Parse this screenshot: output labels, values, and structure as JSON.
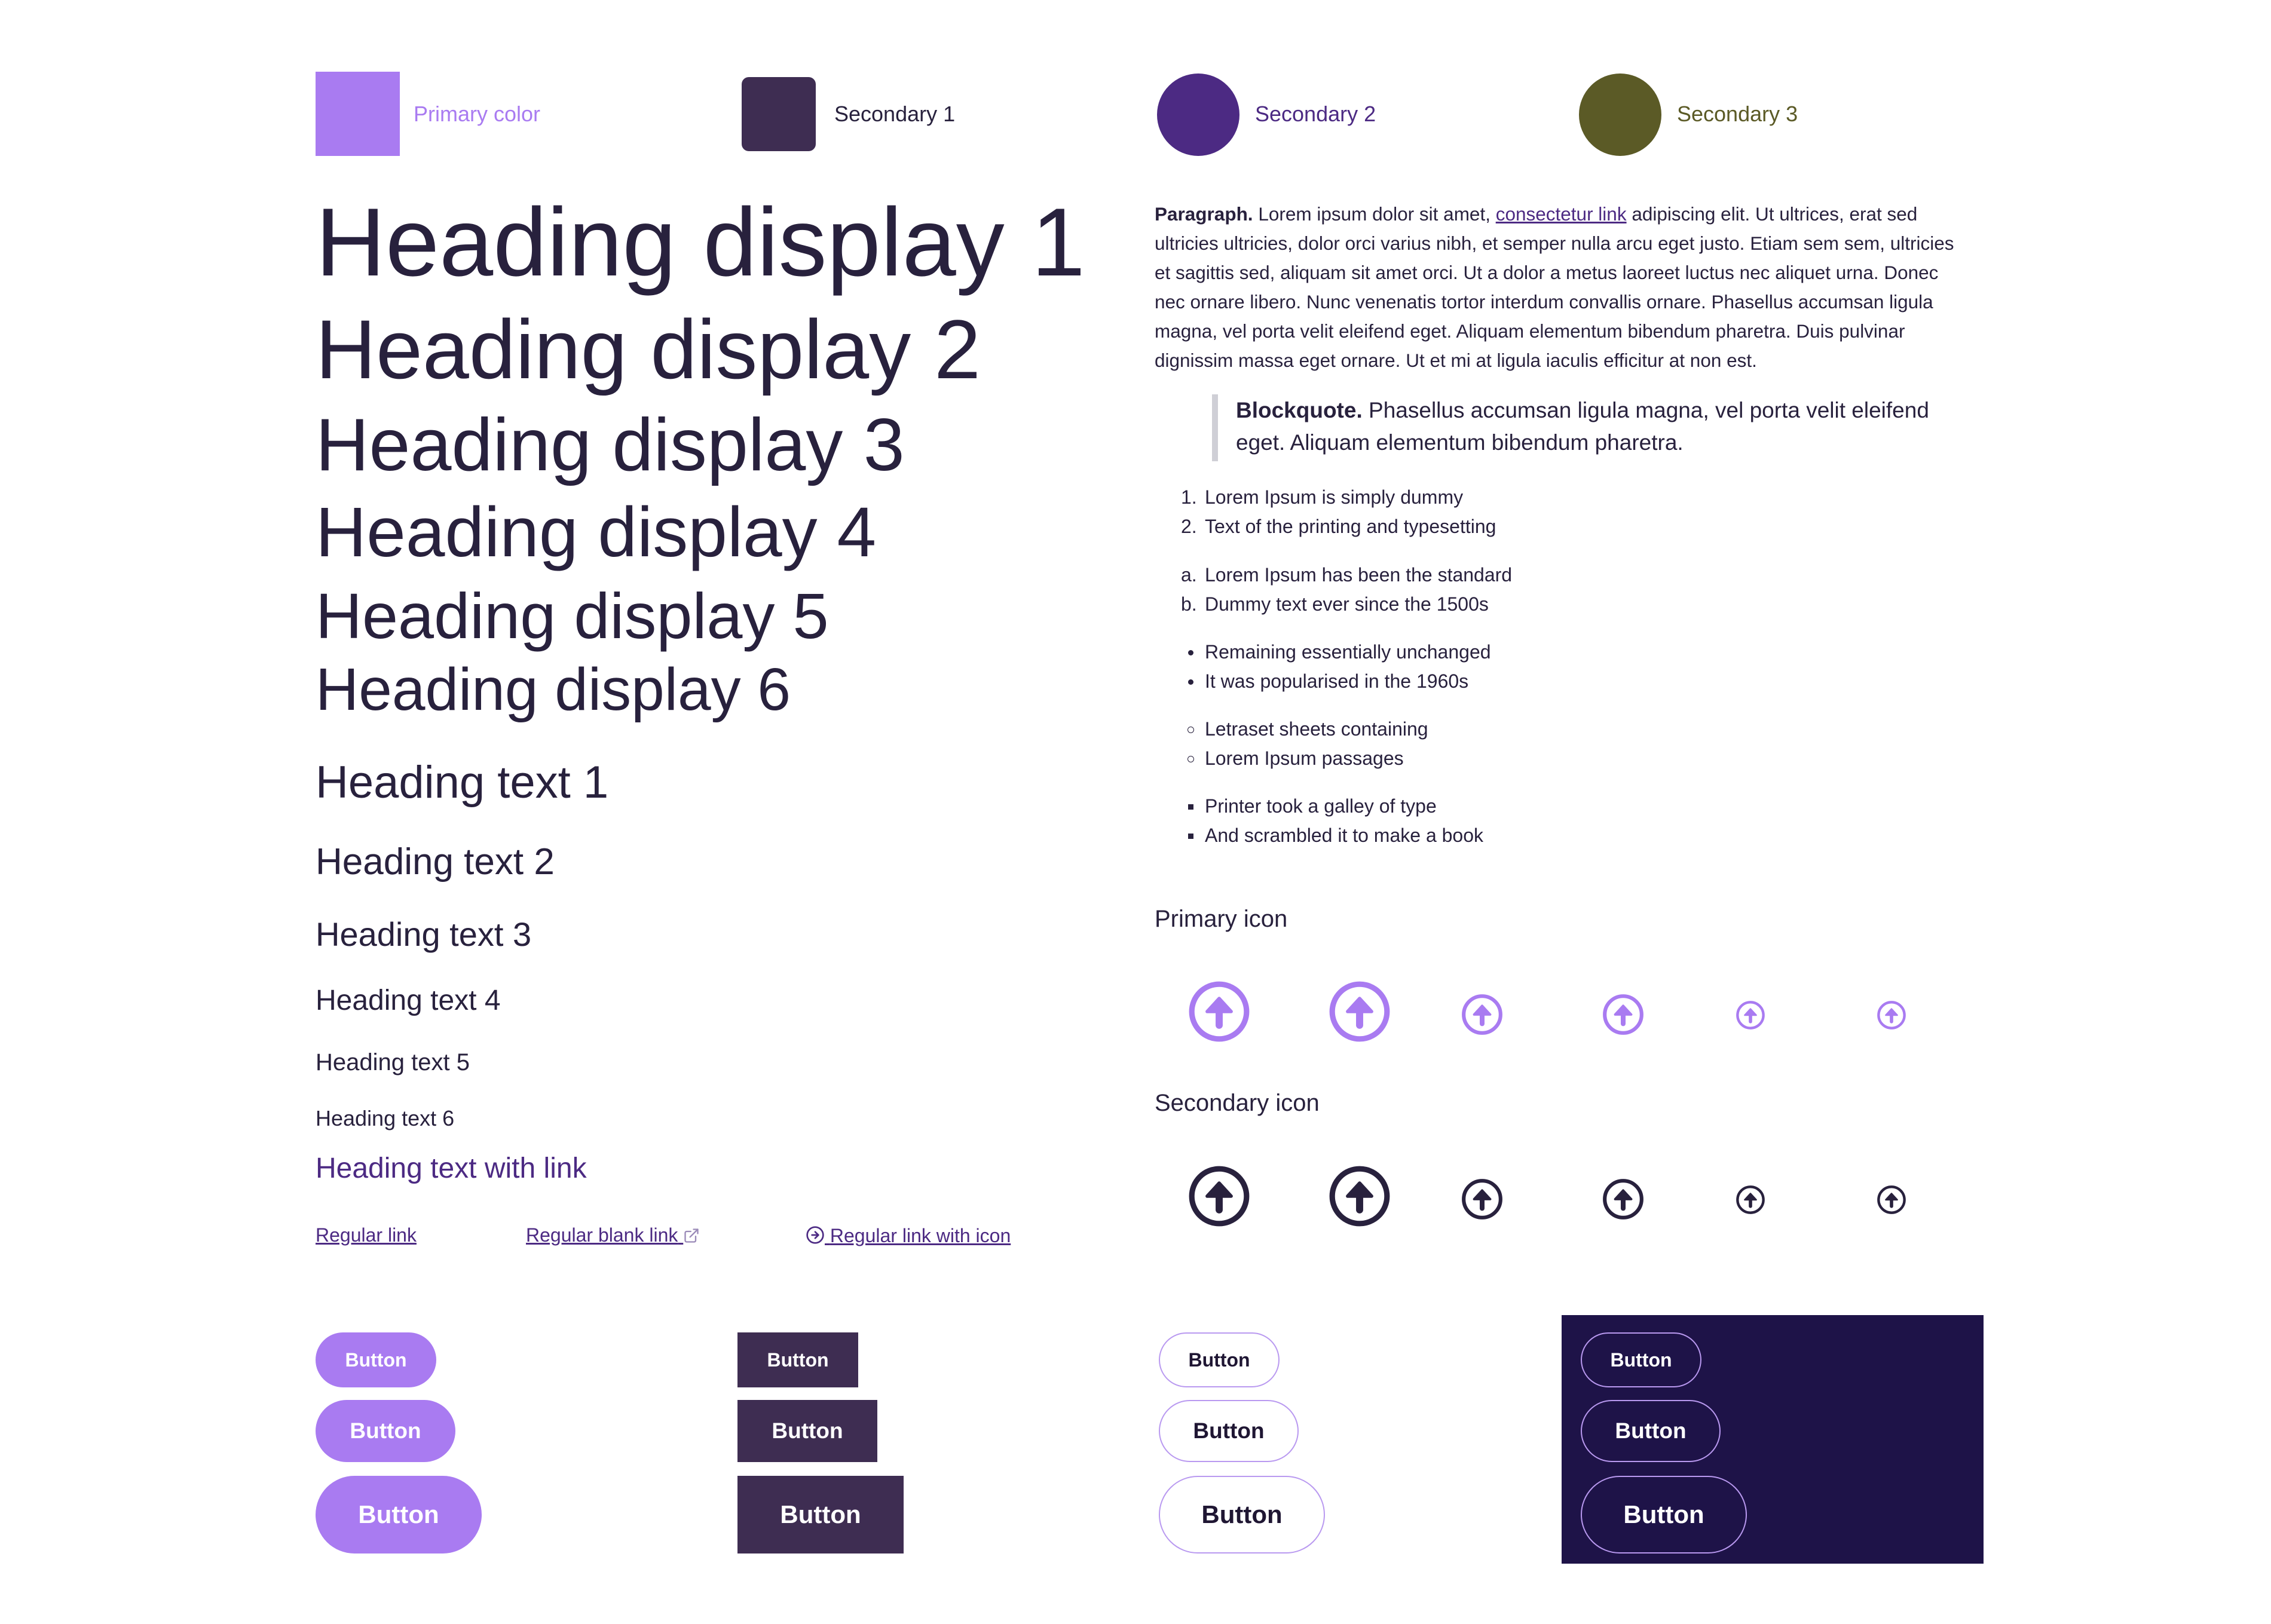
{
  "colors": {
    "primary": "#a97bf1",
    "secondary1": "#3e2d52",
    "secondary2": "#4c2a83",
    "secondary3": "#5b5a26",
    "text": "#28213d",
    "link": "#4c2a83",
    "dark_panel": "#1e1348"
  },
  "swatches": [
    {
      "label": "Primary color"
    },
    {
      "label": "Secondary 1"
    },
    {
      "label": "Secondary 2"
    },
    {
      "label": "Secondary 3"
    }
  ],
  "headings": {
    "display1": "Heading display 1",
    "display2": "Heading display 2",
    "display3": "Heading display 3",
    "display4": "Heading display 4",
    "display5": "Heading display 5",
    "display6": "Heading display 6",
    "text1": "Heading text 1",
    "text2": "Heading text 2",
    "text3": "Heading text 3",
    "text4": "Heading text 4",
    "text5": "Heading text 5",
    "text6": "Heading text 6",
    "link": "Heading text with link"
  },
  "links": {
    "regular": "Regular link",
    "blank": "Regular blank link",
    "with_icon": "Regular link with icon"
  },
  "paragraph": {
    "lead": "Paragraph.",
    "before_link": " Lorem ipsum dolor sit amet, ",
    "link": "consectetur link",
    "after_link": " adipiscing elit. Ut ultrices, erat sed ultricies ultricies, dolor orci varius nibh, et semper nulla arcu eget justo. Etiam sem sem, ultricies et sagittis sed, aliquam sit amet orci. Ut a dolor a metus laoreet luctus nec aliquet urna. Donec nec ornare libero. Nunc venenatis tortor interdum convallis ornare. Phasellus accumsan ligula magna, vel porta velit eleifend eget. Aliquam elementum bibendum pharetra. Duis pulvinar dignissim massa eget ornare. Ut et mi at ligula iaculis efficitur at non est."
  },
  "blockquote": {
    "lead": "Blockquote.",
    "text": " Phasellus accumsan ligula magna, vel porta velit eleifend eget. Aliquam elementum bibendum pharetra."
  },
  "lists": {
    "ordered_numeric": [
      {
        "marker": "1.",
        "text": "Lorem Ipsum is simply dummy"
      },
      {
        "marker": "2.",
        "text": "Text of the printing and typesetting"
      }
    ],
    "ordered_alpha": [
      {
        "marker": "a.",
        "text": "Lorem Ipsum has been the standard"
      },
      {
        "marker": "b.",
        "text": "Dummy text ever since the 1500s"
      }
    ],
    "disc": [
      "Remaining essentially unchanged",
      "It was popularised in the 1960s"
    ],
    "circle": [
      "Letraset sheets containing",
      "Lorem Ipsum passages"
    ],
    "square": [
      "Printer took a galley of type",
      "And scrambled it to make a book"
    ]
  },
  "icons": {
    "primary_title": "Primary icon",
    "secondary_title": "Secondary icon",
    "icon_name": "arrow-up-circle-icon"
  },
  "buttons": {
    "label": "Button"
  }
}
